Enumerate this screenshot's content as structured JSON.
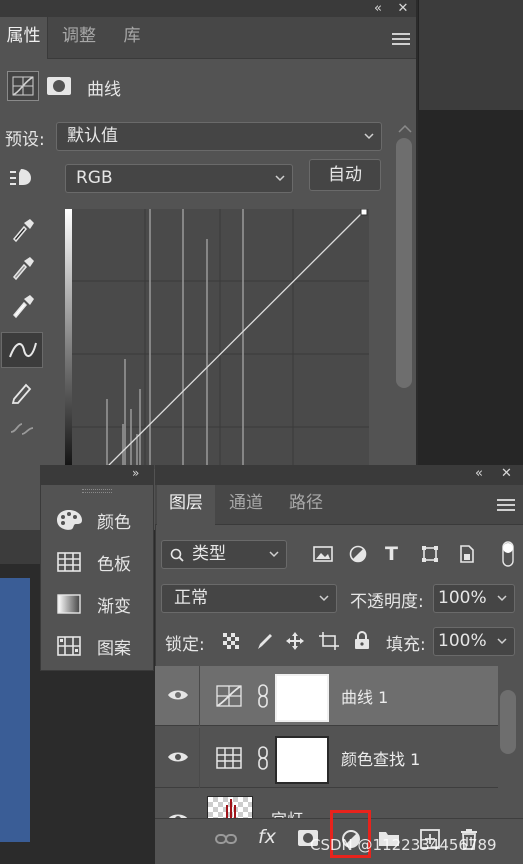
{
  "properties_panel": {
    "tabs": [
      "属性",
      "调整",
      "库"
    ],
    "title": "曲线",
    "preset_label": "预设:",
    "preset_value": "默认值",
    "channel_value": "RGB",
    "auto_button": "自动"
  },
  "swatches_panel": {
    "items": [
      {
        "label": "颜色",
        "icon": "palette-icon"
      },
      {
        "label": "色板",
        "icon": "grid-icon"
      },
      {
        "label": "渐变",
        "icon": "gradient-icon"
      },
      {
        "label": "图案",
        "icon": "pattern-icon"
      }
    ]
  },
  "layers_panel": {
    "tabs": [
      "图层",
      "通道",
      "路径"
    ],
    "filter_value": "类型",
    "blend_mode": "正常",
    "opacity_label": "不透明度:",
    "opacity_value": "100%",
    "lock_label": "锁定:",
    "fill_label": "填充:",
    "fill_value": "100%",
    "layers": [
      {
        "name": "曲线 1",
        "selected": true
      },
      {
        "name": "颜色查找 1",
        "selected": false
      },
      {
        "name": "宫灯",
        "selected": false
      }
    ]
  },
  "watermark": "CSDN @1122334456789",
  "colors": {
    "panel": "#535353",
    "highlight_box": "#e8231c",
    "doc_blue": "#3a5d96"
  }
}
